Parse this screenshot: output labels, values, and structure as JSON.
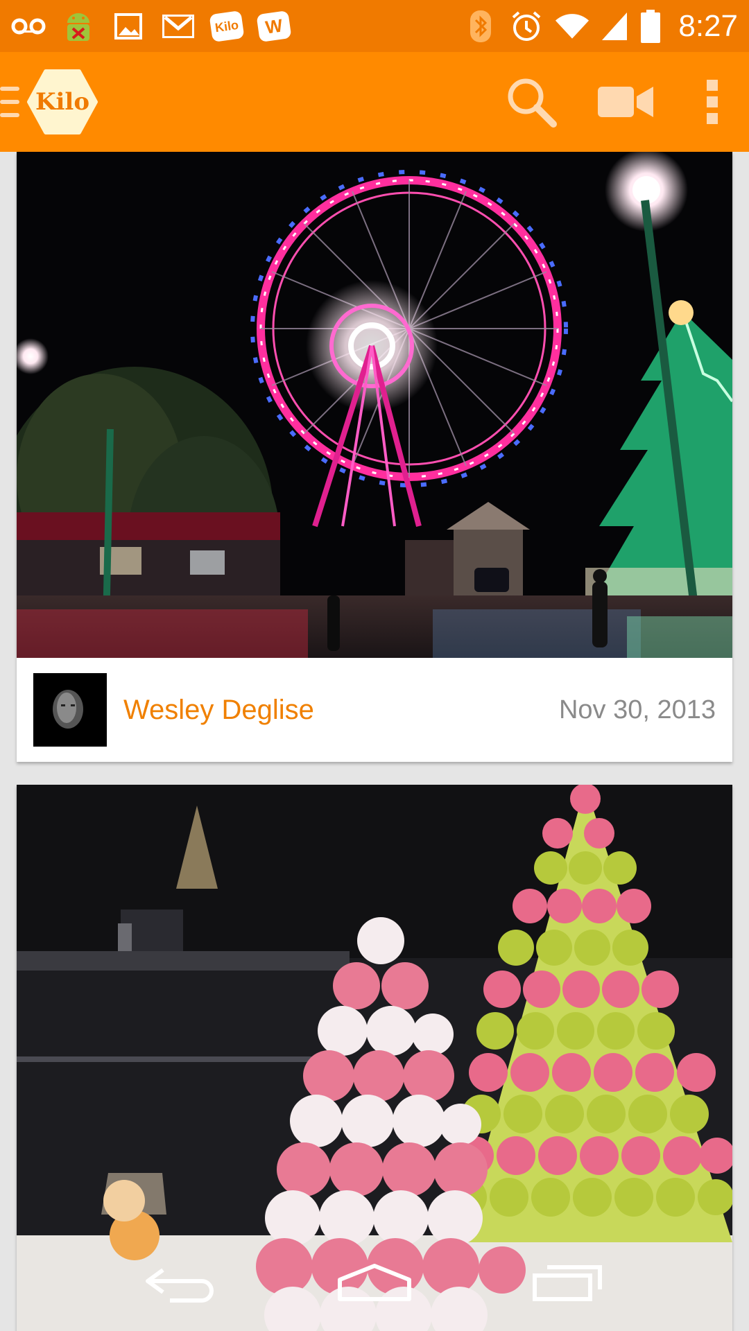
{
  "status_bar": {
    "time": "8:27",
    "left_icons": [
      "voicemail-icon",
      "android-debug-icon",
      "gallery-icon",
      "gmail-icon",
      "kilo-notification-icon",
      "w-notification-icon"
    ],
    "kilo_badge": "Kilo",
    "w_badge": "W",
    "right_icons": [
      "bluetooth-icon",
      "alarm-icon",
      "wifi-icon",
      "signal-icon",
      "battery-icon"
    ]
  },
  "app_bar": {
    "logo_text": "Kilo",
    "actions": [
      "search-icon",
      "video-camera-icon",
      "overflow-menu-icon"
    ],
    "colors": {
      "bar": "#ff8a00",
      "status": "#f07a00",
      "logo_bg": "#fff5cf"
    }
  },
  "feed": {
    "posts": [
      {
        "author": "Wesley Deglise",
        "date": "Nov 30, 2013",
        "photo": "ferris-wheel-night"
      },
      {
        "author": "",
        "date": "",
        "photo": "macaron-towers"
      }
    ],
    "colors": {
      "author": "#f08000",
      "date": "#8a8a8a"
    }
  },
  "nav_bar": {
    "buttons": [
      "back-icon",
      "home-icon",
      "recents-icon"
    ]
  }
}
